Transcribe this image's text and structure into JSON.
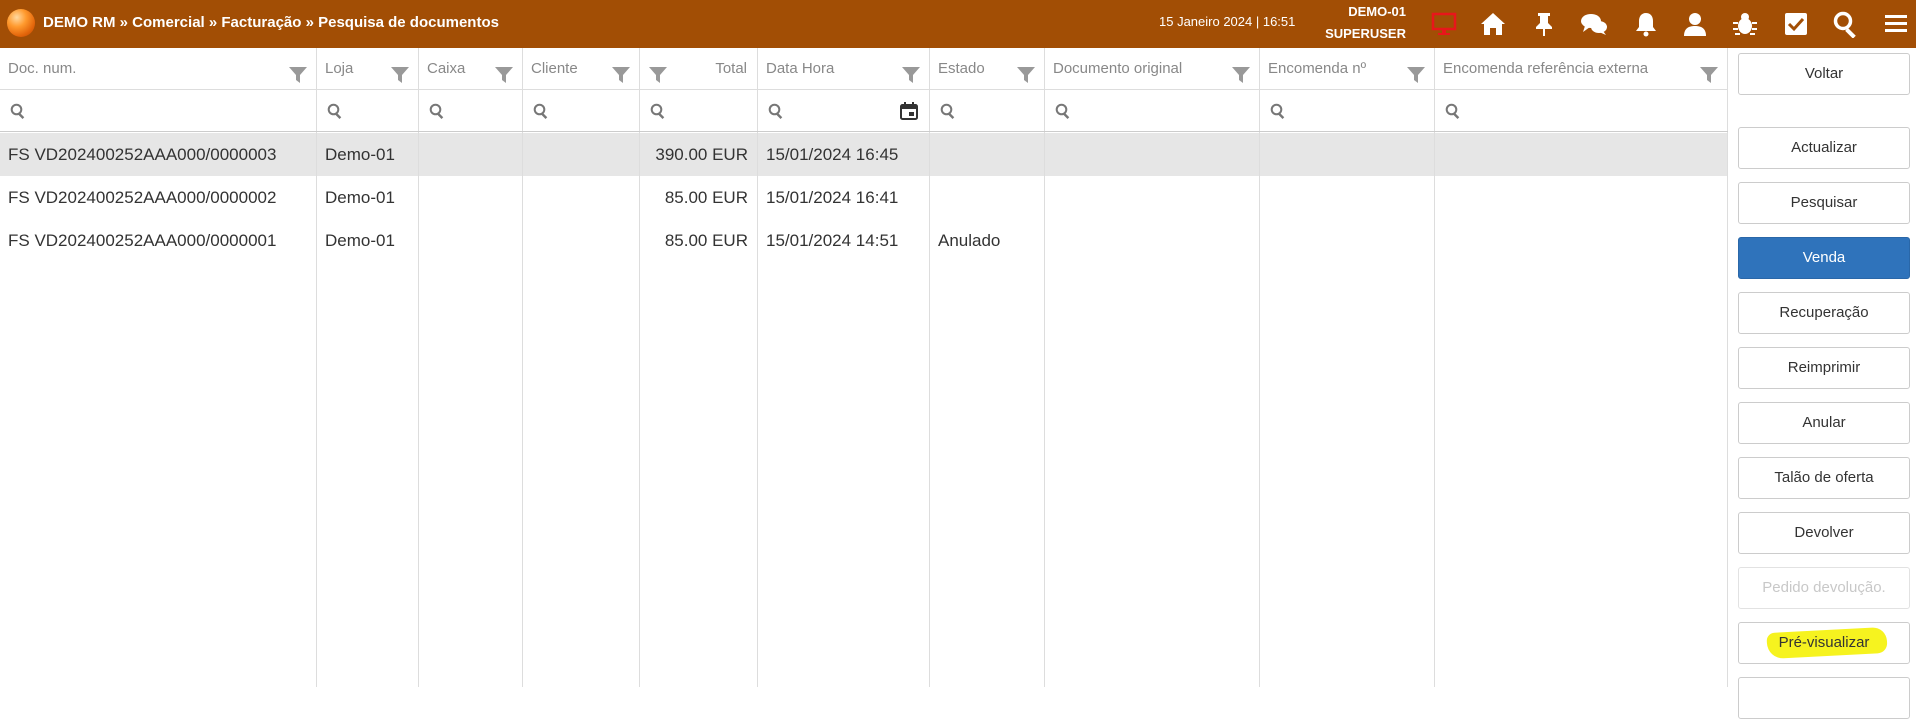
{
  "header": {
    "breadcrumb": "DEMO RM » Comercial » Facturação » Pesquisa de documentos",
    "datetime": "15 Janeiro 2024 | 16:51",
    "store": "DEMO-01",
    "user": "SUPERUSER",
    "icons": [
      "monitor-icon",
      "home-icon",
      "pin-icon",
      "chat-icon",
      "bell-icon",
      "user-icon",
      "bug-icon",
      "checkbox-icon",
      "search-icon",
      "menu-icon"
    ],
    "monitor_color": "#e8161b",
    "bar_color": "#a24e05"
  },
  "table": {
    "columns": [
      {
        "key": "doc",
        "label": "Doc. num."
      },
      {
        "key": "loja",
        "label": "Loja"
      },
      {
        "key": "caixa",
        "label": "Caixa"
      },
      {
        "key": "cliente",
        "label": "Cliente"
      },
      {
        "key": "total",
        "label": "Total"
      },
      {
        "key": "datahora",
        "label": "Data Hora"
      },
      {
        "key": "estado",
        "label": "Estado"
      },
      {
        "key": "original",
        "label": "Documento original"
      },
      {
        "key": "encomenda",
        "label": "Encomenda nº"
      },
      {
        "key": "encref",
        "label": "Encomenda referência externa"
      }
    ],
    "rows": [
      {
        "doc": "FS VD202400252AAA000/0000003",
        "loja": "Demo-01",
        "caixa": "",
        "cliente": "",
        "total": "390.00 EUR",
        "datahora": "15/01/2024 16:45",
        "estado": "",
        "selected": true
      },
      {
        "doc": "FS VD202400252AAA000/0000002",
        "loja": "Demo-01",
        "caixa": "",
        "cliente": "",
        "total": "85.00 EUR",
        "datahora": "15/01/2024 16:41",
        "estado": "",
        "selected": false
      },
      {
        "doc": "FS VD202400252AAA000/0000001",
        "loja": "Demo-01",
        "caixa": "",
        "cliente": "",
        "total": "85.00 EUR",
        "datahora": "15/01/2024 14:51",
        "estado": "Anulado",
        "selected": false
      }
    ]
  },
  "actions": {
    "voltar": "Voltar",
    "actualizar": "Actualizar",
    "pesquisar": "Pesquisar",
    "venda": "Venda",
    "recuperacao": "Recuperação",
    "reimprimir": "Reimprimir",
    "anular": "Anular",
    "talao": "Talão de oferta",
    "devolver": "Devolver",
    "pedido": "Pedido devolução.",
    "previsualizar": "Pré-visualizar",
    "primary_color": "#2f73bb",
    "highlight_color": "#f6f31f"
  }
}
